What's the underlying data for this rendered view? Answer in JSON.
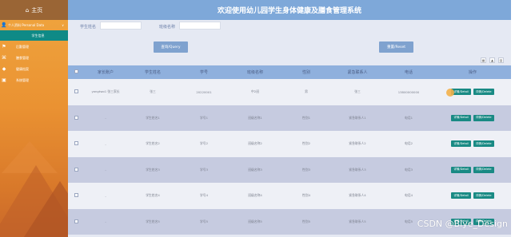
{
  "sidebar": {
    "home_label": "主页",
    "items": [
      {
        "label": "个人资料 Personal Data",
        "icon": "user-icon",
        "has_chevron": true
      },
      {
        "label": "学生信息",
        "icon": "",
        "active": true
      },
      {
        "label": "后勤管理",
        "icon": "truck-icon"
      },
      {
        "label": "膳食管理",
        "icon": "grid-icon"
      },
      {
        "label": "健康档案",
        "icon": "tag-icon"
      },
      {
        "label": "系统管理",
        "icon": "monitor-icon"
      }
    ]
  },
  "header": {
    "title": "欢迎使用幼儿园学生身体健康及膳食管理系统"
  },
  "search": {
    "label1": "学生姓名",
    "label2": "班级名称",
    "value1": "",
    "value2": ""
  },
  "buttons": {
    "query": "查询/Query",
    "reset": "重置/Reset"
  },
  "toolbar_icons": [
    "print-icon",
    "export-icon",
    "columns-icon"
  ],
  "table": {
    "headers": [
      "家长账户",
      "学生姓名",
      "学号",
      "班级名称",
      "性别",
      "紧急联系人",
      "电话",
      "操作"
    ],
    "rows": [
      [
        "yangtwo1 张三家长",
        "张三",
        "20220001",
        "中2班",
        "男",
        "张三",
        "13800000000"
      ],
      [
        "-",
        "学生姓名1",
        "学号1",
        "班级名称1",
        "性别1",
        "紧急联系人1",
        "电话1"
      ],
      [
        "-",
        "学生姓名2",
        "学号2",
        "班级名称2",
        "性别2",
        "紧急联系人2",
        "电话2"
      ],
      [
        "-",
        "学生姓名3",
        "学号3",
        "班级名称3",
        "性别3",
        "紧急联系人3",
        "电话3"
      ],
      [
        "-",
        "学生姓名4",
        "学号4",
        "班级名称4",
        "性别4",
        "紧急联系人4",
        "电话4"
      ],
      [
        "-",
        "学生姓名5",
        "学号5",
        "班级名称5",
        "性别5",
        "紧急联系人5",
        "电话5"
      ]
    ],
    "op_edit": "详情/Detail",
    "op_delete": "详情/Delete"
  },
  "watermark": "CSDN @Biye_Design",
  "colors": {
    "header": "#7ea8d9",
    "sidebar": "#ea9232",
    "teal": "#198a84",
    "table_head": "#8fb0dd"
  }
}
